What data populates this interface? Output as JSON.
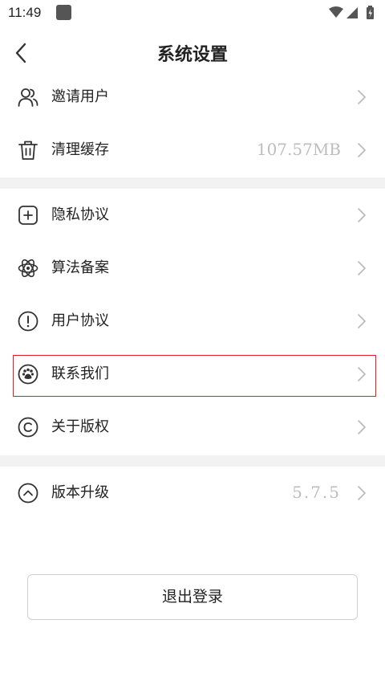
{
  "status_bar": {
    "time": "11:49"
  },
  "header": {
    "title": "系统设置"
  },
  "group1": [
    {
      "label": "邀请用户",
      "value": "",
      "icon": "users-icon"
    },
    {
      "label": "清理缓存",
      "value": "107.57MB",
      "icon": "trash-icon"
    }
  ],
  "group2": [
    {
      "label": "隐私协议",
      "icon": "plus-square-icon"
    },
    {
      "label": "算法备案",
      "icon": "atom-icon"
    },
    {
      "label": "用户协议",
      "icon": "alert-circle-icon"
    },
    {
      "label": "联系我们",
      "icon": "paw-icon"
    },
    {
      "label": "关于版权",
      "icon": "copyright-icon"
    }
  ],
  "group3": [
    {
      "label": "版本升级",
      "value": "5.7.5",
      "icon": "chevron-up-circle-icon"
    }
  ],
  "logout_label": "退出登录",
  "colors": {
    "highlight": "#e02020",
    "divider": "#f2f2f2",
    "value_text": "#bdbdbd"
  }
}
